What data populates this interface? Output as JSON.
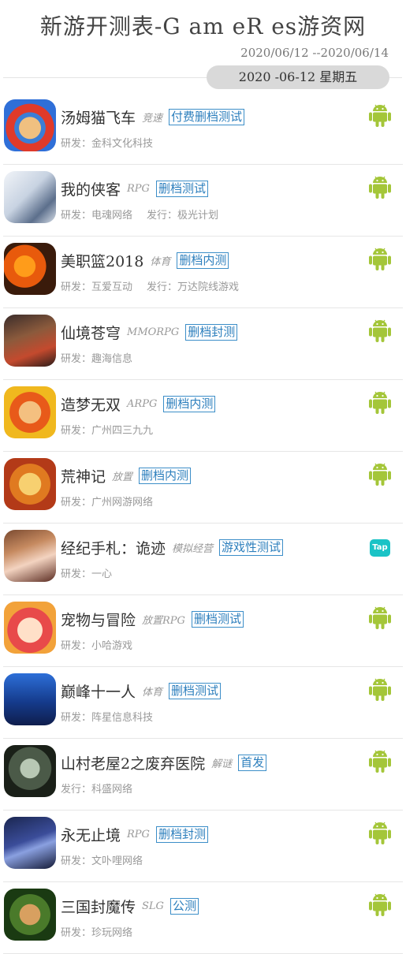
{
  "header": {
    "title": "新游开测表-G am eR es游资网",
    "date_range": "2020/06/12 --2020/06/14",
    "current_date": "2020 -06-12 星期五"
  },
  "colors": {
    "accent_blue": "#2d7fbd",
    "android_green": "#a4c639",
    "tap_cyan": "#1ac3c6"
  },
  "games": [
    {
      "name": "汤姆猫飞车",
      "genre": "竞速",
      "test": "付费删档测试",
      "dev_label": "研发：",
      "dev": "金科文化科技",
      "pub_label": "",
      "pub": "",
      "platform": "android-icon",
      "icon": "tom-cat-racer-icon"
    },
    {
      "name": "我的侠客",
      "genre": "RPG",
      "test": "删档测试",
      "dev_label": "研发：",
      "dev": "电魂网络",
      "pub_label": "发行：",
      "pub": "极光计划",
      "platform": "android-icon",
      "icon": "wuxia-hero-icon"
    },
    {
      "name": "美职篮2018",
      "genre": "体育",
      "test": "删档内测",
      "dev_label": "研发：",
      "dev": "互爱互动",
      "pub_label": "发行：",
      "pub": "万达院线游戏",
      "platform": "android-icon",
      "icon": "nba-icon"
    },
    {
      "name": "仙境苍穹",
      "genre": "MMORPG",
      "test": "删档封测",
      "dev_label": "研发：",
      "dev": "趣海信息",
      "pub_label": "",
      "pub": "",
      "platform": "android-icon",
      "icon": "fantasy-warrior-icon"
    },
    {
      "name": "造梦无双",
      "genre": "ARPG",
      "test": "删档内测",
      "dev_label": "研发：",
      "dev": "广州四三九九",
      "pub_label": "",
      "pub": "",
      "platform": "android-icon",
      "icon": "monkey-king-icon"
    },
    {
      "name": "荒神记",
      "genre": "放置",
      "test": "删档内测",
      "dev_label": "研发：",
      "dev": "广州网游网络",
      "pub_label": "",
      "pub": "",
      "platform": "android-icon",
      "icon": "cartoon-hero-icon"
    },
    {
      "name": "经纪手札：诡迹",
      "genre": "模拟经营",
      "test": "游戏性测试",
      "dev_label": "研发：",
      "dev": "一心",
      "pub_label": "",
      "pub": "",
      "platform": "taptap-icon",
      "platform_label": "Tap",
      "icon": "anime-girl-icon"
    },
    {
      "name": "宠物与冒险",
      "genre": "放置RPG",
      "test": "删档测试",
      "dev_label": "研发：",
      "dev": "小哈游戏",
      "pub_label": "",
      "pub": "",
      "platform": "android-icon",
      "icon": "pet-adventure-icon"
    },
    {
      "name": "巅峰十一人",
      "genre": "体育",
      "test": "删档测试",
      "dev_label": "研发：",
      "dev": "阵星信息科技",
      "pub_label": "",
      "pub": "",
      "platform": "android-icon",
      "icon": "soccer-icon"
    },
    {
      "name": "山村老屋2之废弃医院",
      "genre": "解谜",
      "test": "首发",
      "dev_label": "发行：",
      "dev": "科盛网络",
      "pub_label": "",
      "pub": "",
      "platform": "android-icon",
      "icon": "horror-face-icon"
    },
    {
      "name": "永无止境",
      "genre": "RPG",
      "test": "删档封测",
      "dev_label": "研发：",
      "dev": "文卟哩网络",
      "pub_label": "",
      "pub": "",
      "platform": "android-icon",
      "icon": "dark-knight-icon"
    },
    {
      "name": "三国封魔传",
      "genre": "SLG",
      "test": "公测",
      "dev_label": "研发：",
      "dev": "珍玩网络",
      "pub_label": "",
      "pub": "",
      "platform": "android-icon",
      "icon": "three-kingdoms-icon"
    }
  ]
}
